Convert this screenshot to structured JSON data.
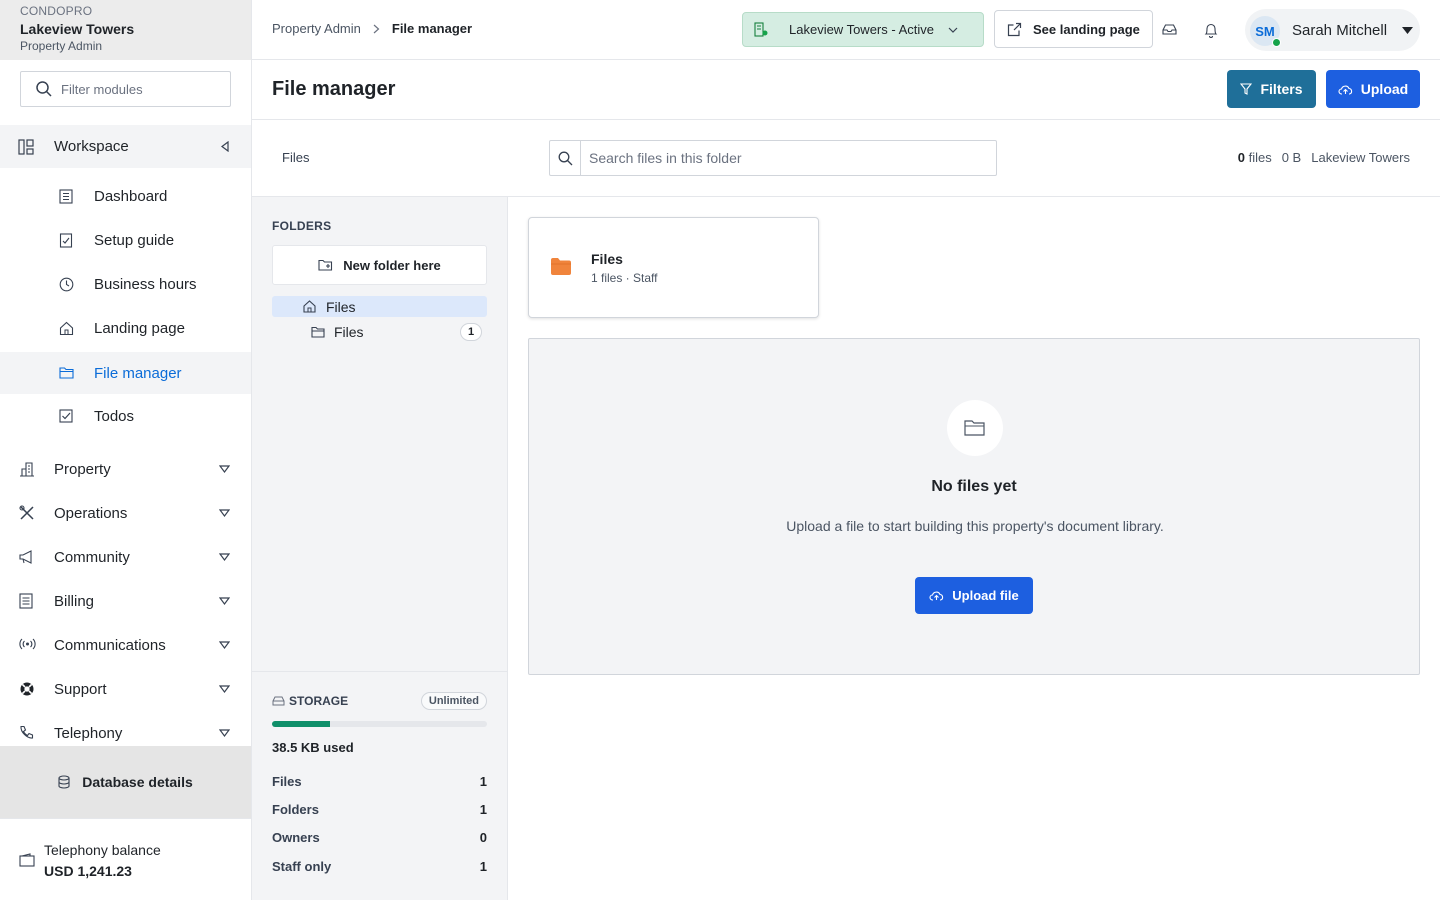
{
  "sidebar": {
    "brand": "CONDOPRO",
    "property": "Lakeview Towers",
    "role": "Property Admin",
    "filter_placeholder": "Filter modules",
    "workspace": "Workspace",
    "workspace_items": [
      {
        "label": "Dashboard",
        "icon": "dashboard-icon"
      },
      {
        "label": "Setup guide",
        "icon": "checklist-icon"
      },
      {
        "label": "Business hours",
        "icon": "clock-icon"
      },
      {
        "label": "Landing page",
        "icon": "home-icon"
      },
      {
        "label": "File manager",
        "icon": "folder-icon",
        "active": true
      },
      {
        "label": "Todos",
        "icon": "todo-check-icon"
      }
    ],
    "groups": [
      {
        "label": "Property",
        "icon": "building-icon"
      },
      {
        "label": "Operations",
        "icon": "tools-icon"
      },
      {
        "label": "Community",
        "icon": "megaphone-icon"
      },
      {
        "label": "Billing",
        "icon": "ledger-icon"
      },
      {
        "label": "Communications",
        "icon": "broadcast-icon"
      },
      {
        "label": "Support",
        "icon": "lifebuoy-icon"
      },
      {
        "label": "Telephony",
        "icon": "phone-icon"
      }
    ],
    "database_details": "Database details",
    "balance_label": "Telephony balance",
    "balance_value": "USD 1,241.23"
  },
  "topbar": {
    "breadcrumb_root": "Property Admin",
    "breadcrumb_current": "File manager",
    "property_pill": "Lakeview Towers - Active",
    "landing_button": "See landing page",
    "user_initials": "SM",
    "user_name": "Sarah Mitchell"
  },
  "page": {
    "title": "File manager",
    "filters_button": "Filters",
    "upload_button": "Upload"
  },
  "search": {
    "folder_label": "Files",
    "placeholder": "Search files in this folder",
    "file_count": "0",
    "file_count_label": "files",
    "size": "0 B",
    "property": "Lakeview Towers"
  },
  "folders": {
    "heading": "FOLDERS",
    "new_folder": "New folder here",
    "root": "Files",
    "child": "Files",
    "child_count": "1"
  },
  "storage": {
    "heading": "STORAGE",
    "badge": "Unlimited",
    "used_fraction": 0.27,
    "used_text": "38.5 KB used",
    "stats": [
      {
        "label": "Files",
        "value": "1"
      },
      {
        "label": "Folders",
        "value": "1"
      },
      {
        "label": "Owners",
        "value": "0"
      },
      {
        "label": "Staff only",
        "value": "1"
      }
    ]
  },
  "folder_card": {
    "name": "Files",
    "meta": "1 files · Staff"
  },
  "empty_state": {
    "title": "No files yet",
    "message": "Upload a file to start building this property's document library.",
    "button": "Upload file"
  },
  "colors": {
    "primary": "#1d5fe0",
    "teal": "#1f6f99",
    "accent_link": "#0b6cd8",
    "folder_orange": "#f0843c",
    "storage_bar": "#0f8f6a",
    "status_green": "#16a34a"
  }
}
